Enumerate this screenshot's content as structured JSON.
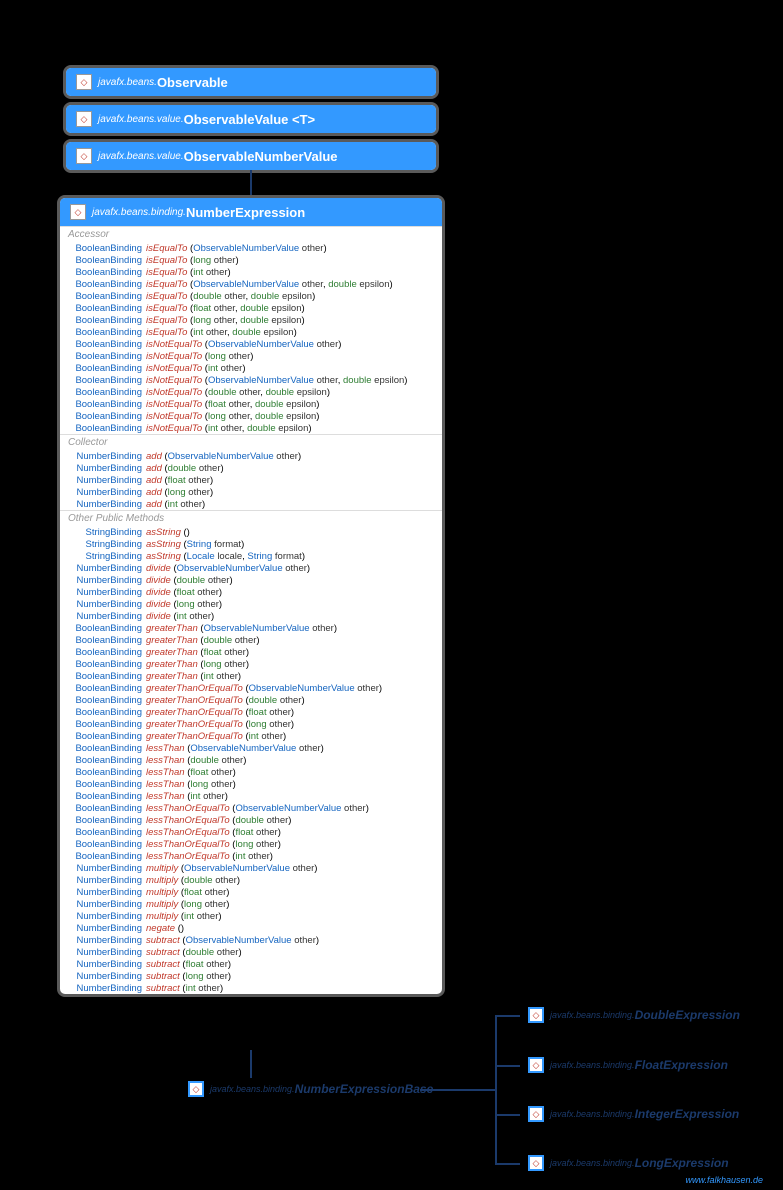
{
  "boxes": {
    "observable": {
      "pkg": "javafx.beans.",
      "cls": "Observable"
    },
    "observableValue": {
      "pkg": "javafx.beans.value.",
      "cls": "ObservableValue <T>"
    },
    "observableNumberValue": {
      "pkg": "javafx.beans.value.",
      "cls": "ObservableNumberValue"
    },
    "numberExpression": {
      "pkg": "javafx.beans.binding.",
      "cls": "NumberExpression"
    },
    "numberExpressionBase": {
      "pkg": "javafx.beans.binding.",
      "cls": "NumberExpressionBase"
    },
    "doubleExpression": {
      "pkg": "javafx.beans.binding.",
      "cls": "DoubleExpression"
    },
    "floatExpression": {
      "pkg": "javafx.beans.binding.",
      "cls": "FloatExpression"
    },
    "integerExpression": {
      "pkg": "javafx.beans.binding.",
      "cls": "IntegerExpression"
    },
    "longExpression": {
      "pkg": "javafx.beans.binding.",
      "cls": "LongExpression"
    }
  },
  "sections": {
    "accessor": "Accessor",
    "collector": "Collector",
    "other": "Other Public Methods"
  },
  "methods": {
    "accessor": [
      {
        "ret": "BooleanBinding",
        "name": "isEqualTo",
        "params": [
          [
            "ObservableNumberValue",
            "other"
          ]
        ]
      },
      {
        "ret": "BooleanBinding",
        "name": "isEqualTo",
        "params": [
          [
            "long",
            "other"
          ]
        ]
      },
      {
        "ret": "BooleanBinding",
        "name": "isEqualTo",
        "params": [
          [
            "int",
            "other"
          ]
        ]
      },
      {
        "ret": "BooleanBinding",
        "name": "isEqualTo",
        "params": [
          [
            "ObservableNumberValue",
            "other"
          ],
          [
            "double",
            "epsilon"
          ]
        ]
      },
      {
        "ret": "BooleanBinding",
        "name": "isEqualTo",
        "params": [
          [
            "double",
            "other"
          ],
          [
            "double",
            "epsilon"
          ]
        ]
      },
      {
        "ret": "BooleanBinding",
        "name": "isEqualTo",
        "params": [
          [
            "float",
            "other"
          ],
          [
            "double",
            "epsilon"
          ]
        ]
      },
      {
        "ret": "BooleanBinding",
        "name": "isEqualTo",
        "params": [
          [
            "long",
            "other"
          ],
          [
            "double",
            "epsilon"
          ]
        ]
      },
      {
        "ret": "BooleanBinding",
        "name": "isEqualTo",
        "params": [
          [
            "int",
            "other"
          ],
          [
            "double",
            "epsilon"
          ]
        ]
      },
      {
        "ret": "BooleanBinding",
        "name": "isNotEqualTo",
        "params": [
          [
            "ObservableNumberValue",
            "other"
          ]
        ]
      },
      {
        "ret": "BooleanBinding",
        "name": "isNotEqualTo",
        "params": [
          [
            "long",
            "other"
          ]
        ]
      },
      {
        "ret": "BooleanBinding",
        "name": "isNotEqualTo",
        "params": [
          [
            "int",
            "other"
          ]
        ]
      },
      {
        "ret": "BooleanBinding",
        "name": "isNotEqualTo",
        "params": [
          [
            "ObservableNumberValue",
            "other"
          ],
          [
            "double",
            "epsilon"
          ]
        ]
      },
      {
        "ret": "BooleanBinding",
        "name": "isNotEqualTo",
        "params": [
          [
            "double",
            "other"
          ],
          [
            "double",
            "epsilon"
          ]
        ]
      },
      {
        "ret": "BooleanBinding",
        "name": "isNotEqualTo",
        "params": [
          [
            "float",
            "other"
          ],
          [
            "double",
            "epsilon"
          ]
        ]
      },
      {
        "ret": "BooleanBinding",
        "name": "isNotEqualTo",
        "params": [
          [
            "long",
            "other"
          ],
          [
            "double",
            "epsilon"
          ]
        ]
      },
      {
        "ret": "BooleanBinding",
        "name": "isNotEqualTo",
        "params": [
          [
            "int",
            "other"
          ],
          [
            "double",
            "epsilon"
          ]
        ]
      }
    ],
    "collector": [
      {
        "ret": "NumberBinding",
        "name": "add",
        "params": [
          [
            "ObservableNumberValue",
            "other"
          ]
        ]
      },
      {
        "ret": "NumberBinding",
        "name": "add",
        "params": [
          [
            "double",
            "other"
          ]
        ]
      },
      {
        "ret": "NumberBinding",
        "name": "add",
        "params": [
          [
            "float",
            "other"
          ]
        ]
      },
      {
        "ret": "NumberBinding",
        "name": "add",
        "params": [
          [
            "long",
            "other"
          ]
        ]
      },
      {
        "ret": "NumberBinding",
        "name": "add",
        "params": [
          [
            "int",
            "other"
          ]
        ]
      }
    ],
    "other": [
      {
        "ret": "StringBinding",
        "name": "asString",
        "params": []
      },
      {
        "ret": "StringBinding",
        "name": "asString",
        "params": [
          [
            "String",
            "format"
          ]
        ]
      },
      {
        "ret": "StringBinding",
        "name": "asString",
        "params": [
          [
            "Locale",
            "locale"
          ],
          [
            "String",
            "format"
          ]
        ]
      },
      {
        "ret": "NumberBinding",
        "name": "divide",
        "params": [
          [
            "ObservableNumberValue",
            "other"
          ]
        ]
      },
      {
        "ret": "NumberBinding",
        "name": "divide",
        "params": [
          [
            "double",
            "other"
          ]
        ]
      },
      {
        "ret": "NumberBinding",
        "name": "divide",
        "params": [
          [
            "float",
            "other"
          ]
        ]
      },
      {
        "ret": "NumberBinding",
        "name": "divide",
        "params": [
          [
            "long",
            "other"
          ]
        ]
      },
      {
        "ret": "NumberBinding",
        "name": "divide",
        "params": [
          [
            "int",
            "other"
          ]
        ]
      },
      {
        "ret": "BooleanBinding",
        "name": "greaterThan",
        "params": [
          [
            "ObservableNumberValue",
            "other"
          ]
        ]
      },
      {
        "ret": "BooleanBinding",
        "name": "greaterThan",
        "params": [
          [
            "double",
            "other"
          ]
        ]
      },
      {
        "ret": "BooleanBinding",
        "name": "greaterThan",
        "params": [
          [
            "float",
            "other"
          ]
        ]
      },
      {
        "ret": "BooleanBinding",
        "name": "greaterThan",
        "params": [
          [
            "long",
            "other"
          ]
        ]
      },
      {
        "ret": "BooleanBinding",
        "name": "greaterThan",
        "params": [
          [
            "int",
            "other"
          ]
        ]
      },
      {
        "ret": "BooleanBinding",
        "name": "greaterThanOrEqualTo",
        "params": [
          [
            "ObservableNumberValue",
            "other"
          ]
        ]
      },
      {
        "ret": "BooleanBinding",
        "name": "greaterThanOrEqualTo",
        "params": [
          [
            "double",
            "other"
          ]
        ]
      },
      {
        "ret": "BooleanBinding",
        "name": "greaterThanOrEqualTo",
        "params": [
          [
            "float",
            "other"
          ]
        ]
      },
      {
        "ret": "BooleanBinding",
        "name": "greaterThanOrEqualTo",
        "params": [
          [
            "long",
            "other"
          ]
        ]
      },
      {
        "ret": "BooleanBinding",
        "name": "greaterThanOrEqualTo",
        "params": [
          [
            "int",
            "other"
          ]
        ]
      },
      {
        "ret": "BooleanBinding",
        "name": "lessThan",
        "params": [
          [
            "ObservableNumberValue",
            "other"
          ]
        ]
      },
      {
        "ret": "BooleanBinding",
        "name": "lessThan",
        "params": [
          [
            "double",
            "other"
          ]
        ]
      },
      {
        "ret": "BooleanBinding",
        "name": "lessThan",
        "params": [
          [
            "float",
            "other"
          ]
        ]
      },
      {
        "ret": "BooleanBinding",
        "name": "lessThan",
        "params": [
          [
            "long",
            "other"
          ]
        ]
      },
      {
        "ret": "BooleanBinding",
        "name": "lessThan",
        "params": [
          [
            "int",
            "other"
          ]
        ]
      },
      {
        "ret": "BooleanBinding",
        "name": "lessThanOrEqualTo",
        "params": [
          [
            "ObservableNumberValue",
            "other"
          ]
        ]
      },
      {
        "ret": "BooleanBinding",
        "name": "lessThanOrEqualTo",
        "params": [
          [
            "double",
            "other"
          ]
        ]
      },
      {
        "ret": "BooleanBinding",
        "name": "lessThanOrEqualTo",
        "params": [
          [
            "float",
            "other"
          ]
        ]
      },
      {
        "ret": "BooleanBinding",
        "name": "lessThanOrEqualTo",
        "params": [
          [
            "long",
            "other"
          ]
        ]
      },
      {
        "ret": "BooleanBinding",
        "name": "lessThanOrEqualTo",
        "params": [
          [
            "int",
            "other"
          ]
        ]
      },
      {
        "ret": "NumberBinding",
        "name": "multiply",
        "params": [
          [
            "ObservableNumberValue",
            "other"
          ]
        ]
      },
      {
        "ret": "NumberBinding",
        "name": "multiply",
        "params": [
          [
            "double",
            "other"
          ]
        ]
      },
      {
        "ret": "NumberBinding",
        "name": "multiply",
        "params": [
          [
            "float",
            "other"
          ]
        ]
      },
      {
        "ret": "NumberBinding",
        "name": "multiply",
        "params": [
          [
            "long",
            "other"
          ]
        ]
      },
      {
        "ret": "NumberBinding",
        "name": "multiply",
        "params": [
          [
            "int",
            "other"
          ]
        ]
      },
      {
        "ret": "NumberBinding",
        "name": "negate",
        "params": []
      },
      {
        "ret": "NumberBinding",
        "name": "subtract",
        "params": [
          [
            "ObservableNumberValue",
            "other"
          ]
        ]
      },
      {
        "ret": "NumberBinding",
        "name": "subtract",
        "params": [
          [
            "double",
            "other"
          ]
        ]
      },
      {
        "ret": "NumberBinding",
        "name": "subtract",
        "params": [
          [
            "float",
            "other"
          ]
        ]
      },
      {
        "ret": "NumberBinding",
        "name": "subtract",
        "params": [
          [
            "long",
            "other"
          ]
        ]
      },
      {
        "ret": "NumberBinding",
        "name": "subtract",
        "params": [
          [
            "int",
            "other"
          ]
        ]
      }
    ]
  },
  "footer": "www.falkhausen.de",
  "keywords": [
    "long",
    "int",
    "double",
    "float"
  ]
}
